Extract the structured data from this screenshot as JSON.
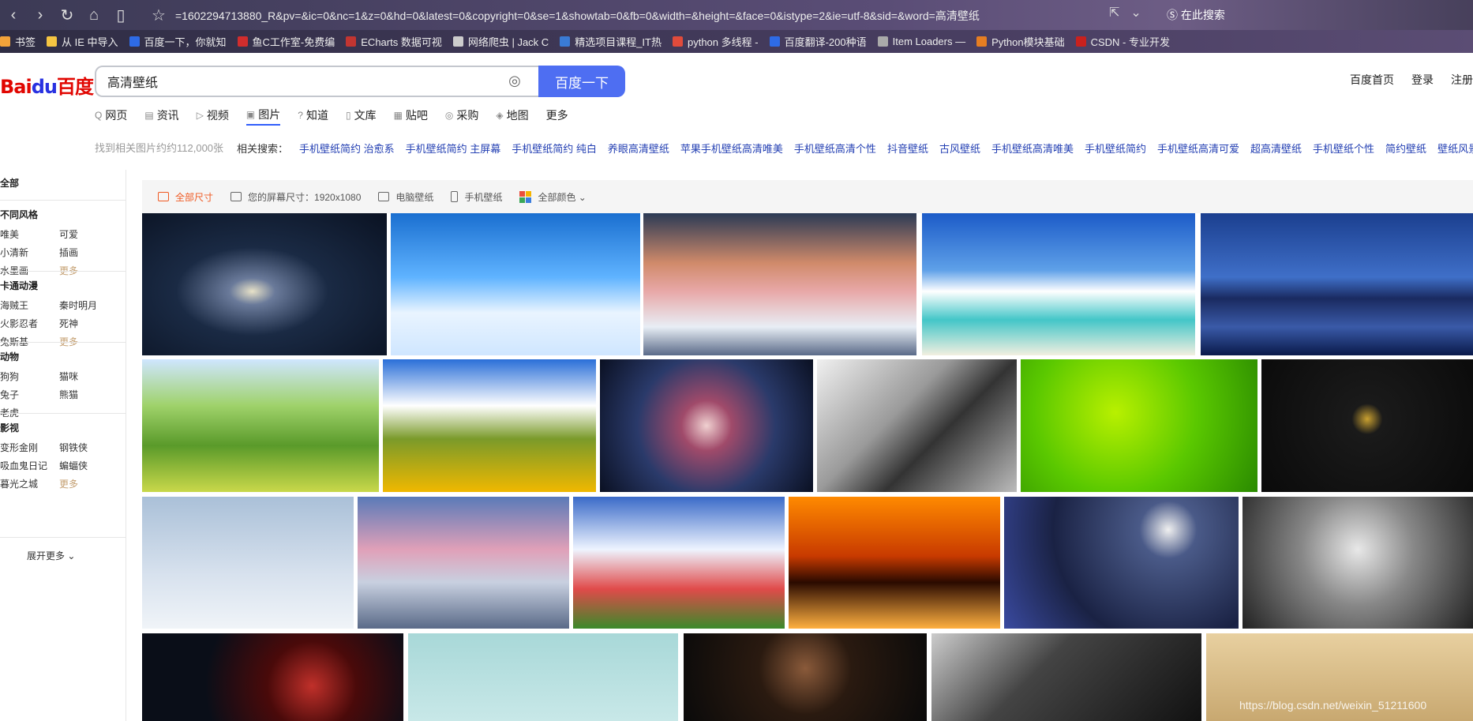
{
  "browser": {
    "url": "=1602294713880_R&pv=&ic=0&nc=1&z=0&hd=0&latest=0&copyright=0&se=1&showtab=0&fb=0&width=&height=&face=0&istype=2&ie=utf-8&sid=&word=高清壁纸",
    "search_label": "在此搜索"
  },
  "bookmarks": [
    {
      "label": "书签",
      "color": "#f2a33a"
    },
    {
      "label": "从 IE 中导入",
      "color": "#f5c542"
    },
    {
      "label": "百度一下，你就知",
      "color": "#2e6be6"
    },
    {
      "label": "鱼C工作室-免费编",
      "color": "#d12d2d"
    },
    {
      "label": "ECharts 数据可视",
      "color": "#c23531"
    },
    {
      "label": "网络爬虫 | Jack C",
      "color": "#cccccc"
    },
    {
      "label": "精选项目课程_IT热",
      "color": "#3a7bd5"
    },
    {
      "label": "python 多线程 - ",
      "color": "#e14b3b"
    },
    {
      "label": "百度翻译-200种语",
      "color": "#2e6be6"
    },
    {
      "label": "Item Loaders —",
      "color": "#aaaaaa"
    },
    {
      "label": "Python模块基础",
      "color": "#e67e22"
    },
    {
      "label": "CSDN - 专业开发",
      "color": "#c9211e"
    }
  ],
  "logo": {
    "part1": "Bai",
    "part2": "du",
    "part3": "百度"
  },
  "search": {
    "query": "高清壁纸",
    "button": "百度一下"
  },
  "top_links": [
    "百度首页",
    "登录",
    "注册"
  ],
  "tabs": [
    {
      "icon": "Q",
      "label": "网页"
    },
    {
      "icon": "▤",
      "label": "资讯"
    },
    {
      "icon": "▷",
      "label": "视频"
    },
    {
      "icon": "▣",
      "label": "图片",
      "active": true
    },
    {
      "icon": "?",
      "label": "知道"
    },
    {
      "icon": "▯",
      "label": "文库"
    },
    {
      "icon": "▦",
      "label": "贴吧"
    },
    {
      "icon": "◎",
      "label": "采购"
    },
    {
      "icon": "◈",
      "label": "地图"
    },
    {
      "icon": "",
      "label": "更多"
    }
  ],
  "result_count": "找到相关图片约约112,000张",
  "related": {
    "label": "相关搜索：",
    "items": [
      "手机壁纸简约 治愈系",
      "手机壁纸简约 主屏幕",
      "手机壁纸简约 纯白",
      "养眼高清壁纸",
      "苹果手机壁纸高清唯美",
      "手机壁纸高清个性",
      "抖音壁纸",
      "古风壁纸",
      "手机壁纸高清唯美",
      "手机壁纸简约",
      "手机壁纸高清可爱",
      "超高清壁纸",
      "手机壁纸个性",
      "简约壁纸",
      "壁纸风景壁纸"
    ]
  },
  "sidebar": {
    "all": "全部",
    "groups": [
      {
        "title": "不同风格",
        "items": [
          "唯美",
          "可爱",
          "小清新",
          "插画",
          "水墨画",
          "更多"
        ]
      },
      {
        "title": "卡通动漫",
        "items": [
          "海贼王",
          "秦时明月",
          "火影忍者",
          "死神",
          "兔斯基",
          "更多"
        ]
      },
      {
        "title": "动物",
        "items": [
          "狗狗",
          "猫咪",
          "兔子",
          "熊猫",
          "老虎"
        ]
      },
      {
        "title": "影视",
        "items": [
          "变形金刚",
          "钢铁侠",
          "吸血鬼日记",
          "蝙蝠侠",
          "暮光之城",
          "更多"
        ]
      }
    ],
    "expand": "展开更多 ⌄"
  },
  "filters": {
    "all_sizes": "全部尺寸",
    "screen_size": "您的屏幕尺寸：1920x1080",
    "pc": "电脑壁纸",
    "mobile": "手机壁纸",
    "all_colors": "全部颜色 ⌄"
  },
  "watermark": "https://blog.csdn.net/weixin_51211600",
  "colors": {
    "accent": "#4e6ef2",
    "orange": "#f05a23",
    "link": "#2440b3"
  }
}
